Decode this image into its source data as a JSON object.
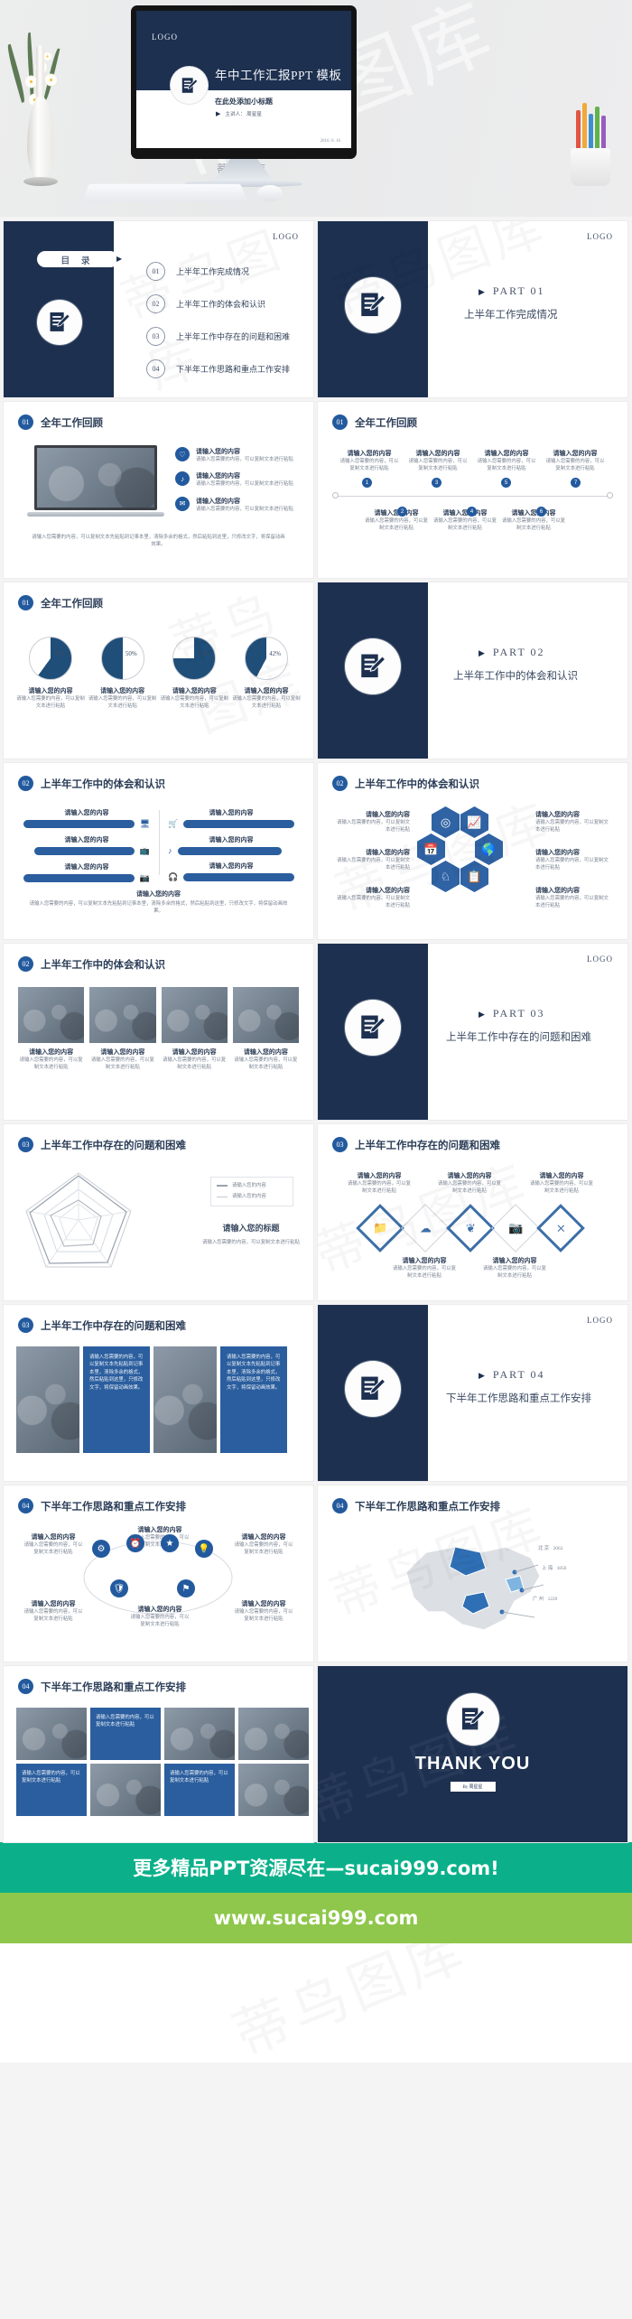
{
  "hero": {
    "logo": "LOGO",
    "title": "年中工作汇报PPT 模板",
    "subtitle": "在此处添加小标题",
    "presenter": "主讲人： 周星星",
    "date": "2016. 6. 16",
    "caption": "蒂鸟图库"
  },
  "labels": {
    "logo": "LOGO",
    "toc_pill": "目 录",
    "part_prefix": "PART",
    "thank_you": "THANK YOU",
    "thank_by": "By 周星星",
    "placeholder_heading": "请输入您的内容",
    "placeholder_body": "请输入您需要的内容，可以复制文本进行粘贴",
    "placeholder_long": "请输入您需要的内容，可以复制文本先粘贴到记事本里，清除多余的格式，然后粘贴到这里，只修改文字，将保留动画效果。",
    "radar_center": "请输入您的标题",
    "legend_1": "请输入您的内容",
    "legend_2": "请输入您的内容"
  },
  "toc": [
    {
      "num": "01",
      "text": "上半年工作完成情况"
    },
    {
      "num": "02",
      "text": "上半年工作的体会和认识"
    },
    {
      "num": "03",
      "text": "上半年工作中存在的问题和困难"
    },
    {
      "num": "04",
      "text": "下半年工作思路和重点工作安排"
    }
  ],
  "sections": [
    {
      "part": "PART  01",
      "title": "上半年工作完成情况"
    },
    {
      "part": "PART  02",
      "title": "上半年工作中的体会和认识"
    },
    {
      "part": "PART  03",
      "title": "上半年工作中存在的问题和困难"
    },
    {
      "part": "PART  04",
      "title": "下半年工作思路和重点工作安排"
    }
  ],
  "slide_titles": {
    "review": "全年工作回顾",
    "insight": "上半年工作中的体会和认识",
    "problems": "上半年工作中存在的问题和困难",
    "plans": "下半年工作思路和重点工作安排"
  },
  "slide_nums": {
    "one": "01",
    "two": "02",
    "three": "03",
    "four": "04"
  },
  "timeline": {
    "steps": [
      "1",
      "2",
      "3",
      "4",
      "5",
      "6",
      "7"
    ]
  },
  "chart_data": {
    "type": "pie",
    "title": "全年工作回顾",
    "charts": [
      {
        "label": "请输入您的内容",
        "value": 60,
        "display": "60%",
        "caption": "请输入您需要的内容，可以复制文本进行粘贴"
      },
      {
        "label": "请输入您的内容",
        "value": 50,
        "display": "50%",
        "caption": "请输入您需要的内容，可以复制文本进行粘贴"
      },
      {
        "label": "请输入您的内容",
        "value": 75,
        "display": "75%",
        "caption": "请输入您需要的内容，可以复制文本进行粘贴"
      },
      {
        "label": "请输入您的内容",
        "value": 42,
        "display": "42%",
        "caption": "请输入您需要的内容，可以复制文本进行粘贴"
      }
    ],
    "colors": {
      "fill": "#1f4e79",
      "track": "#ffffff",
      "stroke": "#c9ced6"
    },
    "radar": {
      "type": "line",
      "shape": "pentagon",
      "series": [
        {
          "name": "请输入您的内容",
          "values": [
            0.95,
            0.9,
            0.92,
            0.88,
            0.9
          ]
        },
        {
          "name": "请输入您的内容",
          "values": [
            0.6,
            0.68,
            0.55,
            0.62,
            0.58
          ]
        }
      ]
    }
  },
  "map": {
    "labels": [
      "北 京",
      "上 海",
      "广 州"
    ],
    "values": [
      "2063",
      "1850",
      "1220"
    ]
  },
  "footer": {
    "line1": "更多精品PPT资源尽在—sucai999.com!",
    "line2": "www.sucai999.com"
  },
  "colors": {
    "navy": "#1d3050",
    "blue": "#2b5e9e",
    "teal": "#0bb08a",
    "green": "#8ec74b"
  },
  "watermark": "蒂鸟图库"
}
